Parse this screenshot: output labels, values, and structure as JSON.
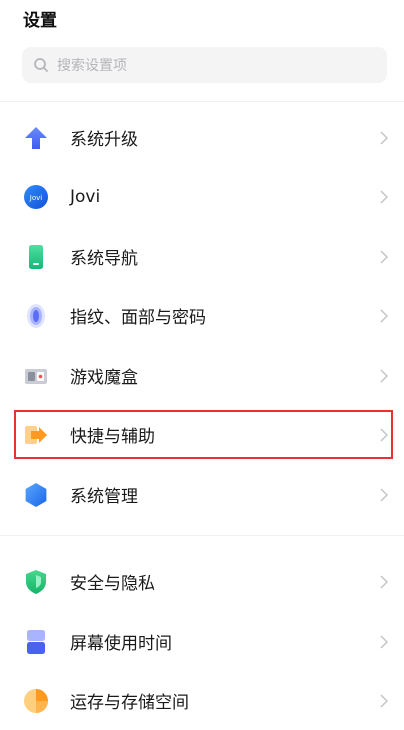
{
  "header": {
    "title": "设置"
  },
  "search": {
    "placeholder": "搜索设置项",
    "icon": "search-icon"
  },
  "colors": {
    "highlight": "#e53333"
  },
  "groups": [
    {
      "items": [
        {
          "label": "系统升级",
          "icon": "arrow-up-icon"
        },
        {
          "label": "Jovi",
          "icon": "jovi-icon"
        },
        {
          "label": "系统导航",
          "icon": "phone-nav-icon"
        },
        {
          "label": "指纹、面部与密码",
          "icon": "fingerprint-icon"
        },
        {
          "label": "游戏魔盒",
          "icon": "game-box-icon"
        },
        {
          "label": "快捷与辅助",
          "icon": "shortcut-icon",
          "highlighted": true
        },
        {
          "label": "系统管理",
          "icon": "hexagon-icon"
        }
      ]
    },
    {
      "items": [
        {
          "label": "安全与隐私",
          "icon": "shield-icon"
        },
        {
          "label": "屏幕使用时间",
          "icon": "screen-time-icon"
        },
        {
          "label": "运存与存储空间",
          "icon": "storage-pie-icon"
        }
      ]
    }
  ]
}
